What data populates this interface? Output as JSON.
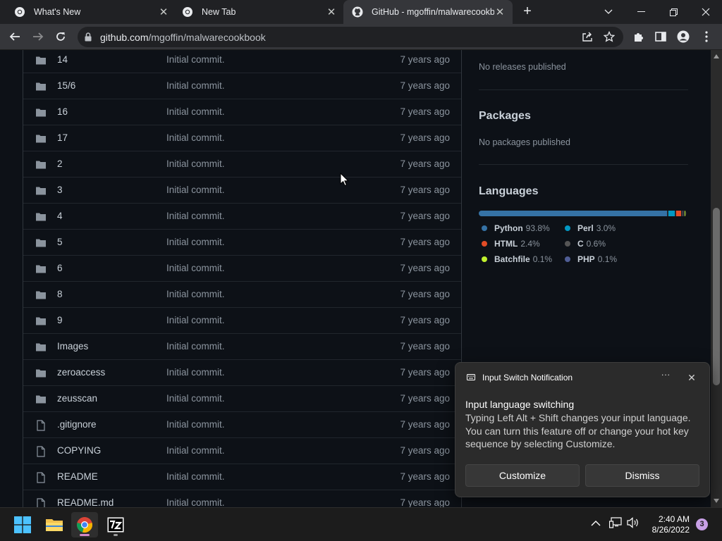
{
  "browser": {
    "tabs": [
      {
        "title": "What's New",
        "active": false
      },
      {
        "title": "New Tab",
        "active": false
      },
      {
        "title": "GitHub - mgoffin/malwarecookb",
        "active": true
      }
    ],
    "url_host": "github.com",
    "url_path": "/mgoffin/malwarecookbook"
  },
  "files": [
    {
      "name": "14",
      "type": "folder",
      "message": "Initial commit.",
      "age": "7 years ago"
    },
    {
      "name": "15/6",
      "type": "folder",
      "message": "Initial commit.",
      "age": "7 years ago"
    },
    {
      "name": "16",
      "type": "folder",
      "message": "Initial commit.",
      "age": "7 years ago"
    },
    {
      "name": "17",
      "type": "folder",
      "message": "Initial commit.",
      "age": "7 years ago"
    },
    {
      "name": "2",
      "type": "folder",
      "message": "Initial commit.",
      "age": "7 years ago"
    },
    {
      "name": "3",
      "type": "folder",
      "message": "Initial commit.",
      "age": "7 years ago"
    },
    {
      "name": "4",
      "type": "folder",
      "message": "Initial commit.",
      "age": "7 years ago"
    },
    {
      "name": "5",
      "type": "folder",
      "message": "Initial commit.",
      "age": "7 years ago"
    },
    {
      "name": "6",
      "type": "folder",
      "message": "Initial commit.",
      "age": "7 years ago"
    },
    {
      "name": "8",
      "type": "folder",
      "message": "Initial commit.",
      "age": "7 years ago"
    },
    {
      "name": "9",
      "type": "folder",
      "message": "Initial commit.",
      "age": "7 years ago"
    },
    {
      "name": "Images",
      "type": "folder",
      "message": "Initial commit.",
      "age": "7 years ago"
    },
    {
      "name": "zeroaccess",
      "type": "folder",
      "message": "Initial commit.",
      "age": "7 years ago"
    },
    {
      "name": "zeusscan",
      "type": "folder",
      "message": "Initial commit.",
      "age": "7 years ago"
    },
    {
      "name": ".gitignore",
      "type": "file",
      "message": "Initial commit.",
      "age": "7 years ago"
    },
    {
      "name": "COPYING",
      "type": "file",
      "message": "Initial commit.",
      "age": "7 years ago"
    },
    {
      "name": "README",
      "type": "file",
      "message": "Initial commit.",
      "age": "7 years ago"
    },
    {
      "name": "README.md",
      "type": "file",
      "message": "Initial commit.",
      "age": "7 years ago"
    }
  ],
  "sidebar": {
    "releases_text": "No releases published",
    "packages_title": "Packages",
    "packages_text": "No packages published",
    "languages_title": "Languages",
    "languages": [
      {
        "name": "Python",
        "percent": "93.8%",
        "share": 93.8,
        "color": "#3572A5"
      },
      {
        "name": "Perl",
        "percent": "3.0%",
        "share": 3.0,
        "color": "#0298c3"
      },
      {
        "name": "HTML",
        "percent": "2.4%",
        "share": 2.4,
        "color": "#e34c26"
      },
      {
        "name": "C",
        "percent": "0.6%",
        "share": 0.6,
        "color": "#555555"
      },
      {
        "name": "Batchfile",
        "percent": "0.1%",
        "share": 0.1,
        "color": "#C1F12E"
      },
      {
        "name": "PHP",
        "percent": "0.1%",
        "share": 0.1,
        "color": "#4F5D95"
      }
    ]
  },
  "notification": {
    "app": "Input Switch Notification",
    "more": "···",
    "heading": "Input language switching",
    "body": "Typing Left Alt + Shift changes your input language. You can turn this feature off or change your hot key sequence by selecting Customize.",
    "customize_label": "Customize",
    "dismiss_label": "Dismiss"
  },
  "taskbar": {
    "time": "2:40 AM",
    "date": "8/26/2022",
    "notification_count": "3"
  }
}
